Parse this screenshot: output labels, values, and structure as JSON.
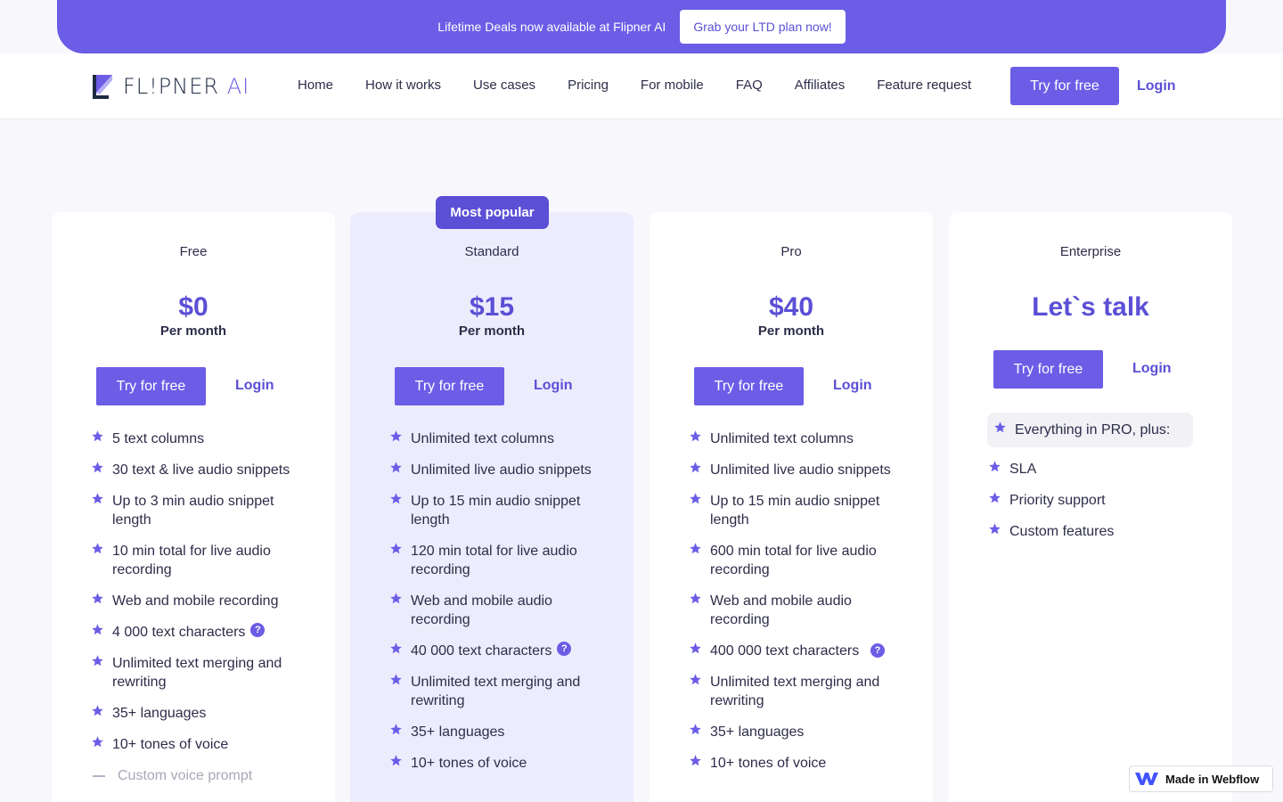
{
  "banner": {
    "text": "Lifetime Deals now available at Flipner AI",
    "cta": "Grab your LTD plan now!"
  },
  "header": {
    "logo_text": "FL!PNER",
    "logo_ai": "AI",
    "nav": [
      "Home",
      "How it works",
      "Use cases",
      "Pricing",
      "For mobile",
      "FAQ",
      "Affiliates",
      "Feature request"
    ],
    "try_label": "Try for free",
    "login_label": "Login"
  },
  "badge": "Most popular",
  "plans": [
    {
      "name": "Free",
      "price": "$0",
      "per": "Per month",
      "try": "Try for free",
      "login": "Login",
      "features": [
        "5 text columns",
        "30 text & live audio snippets",
        "Up to 3 min audio snippet length",
        "10 min total for live audio recording",
        "Web and mobile recording",
        "4 000 text characters",
        "Unlimited text merging and rewriting",
        "35+ languages",
        "10+ tones of voice"
      ],
      "muted": [
        "Custom voice prompt"
      ]
    },
    {
      "name": "Standard",
      "price": "$15",
      "per": "Per month",
      "try": "Try for free",
      "login": "Login",
      "features": [
        "Unlimited text columns",
        "Unlimited live audio snippets",
        "Up to 15 min audio snippet length",
        "120 min total for live audio recording",
        "Web and mobile audio recording",
        "40 000 text characters",
        "Unlimited text merging and rewriting",
        "35+ languages",
        "10+ tones of voice"
      ]
    },
    {
      "name": "Pro",
      "price": "$40",
      "per": "Per month",
      "try": "Try for free",
      "login": "Login",
      "features": [
        "Unlimited text columns",
        "Unlimited live audio snippets",
        "Up to 15 min audio snippet length",
        "600 min total for live audio recording",
        "Web and mobile audio recording",
        "400 000 text characters",
        "Unlimited text merging and rewriting",
        "35+ languages",
        "10+ tones of voice"
      ]
    },
    {
      "name": "Enterprise",
      "price": "Let`s talk",
      "try": "Try for free",
      "login": "Login",
      "plus": "Everything in PRO, plus:",
      "features": [
        "SLA",
        "Priority support",
        "Custom features"
      ]
    }
  ],
  "help_icon": "?",
  "webflow": "Made in Webflow",
  "colors": {
    "accent": "#6b5de6",
    "popular_bg": "#ececfd"
  }
}
